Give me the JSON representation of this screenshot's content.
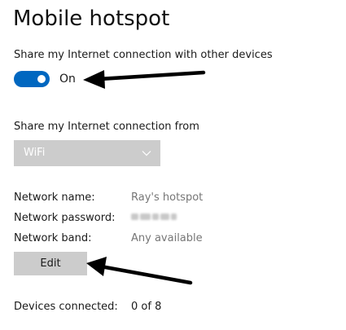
{
  "page": {
    "title": "Mobile hotspot"
  },
  "sharing": {
    "label": "Share my Internet connection with other devices",
    "toggle_state": "On",
    "toggle_on": true,
    "accent_color": "#0067c0"
  },
  "connection_source": {
    "label": "Share my Internet connection from",
    "selected": "WiFi",
    "disabled": true
  },
  "network": {
    "name_label": "Network name:",
    "name_value": "Ray's hotspot",
    "password_label": "Network password:",
    "password_value_obscured": true,
    "band_label": "Network band:",
    "band_value": "Any available"
  },
  "actions": {
    "edit_label": "Edit"
  },
  "devices": {
    "label": "Devices connected:",
    "value": "0 of 8"
  },
  "annotations": {
    "arrow_color": "#000000",
    "arrow_targets": [
      "toggle-state",
      "edit-button"
    ]
  },
  "icons": {
    "dropdown": "chevron-down-icon",
    "annotation": "arrow-icon"
  }
}
